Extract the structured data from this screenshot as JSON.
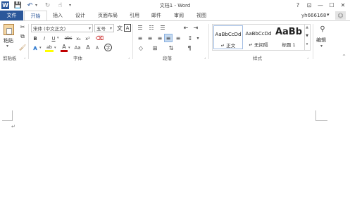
{
  "window": {
    "title": "文档1 - Word",
    "help": "?",
    "ribbon_display": "⊡",
    "minimize": "—",
    "maximize": "☐",
    "close": "✕"
  },
  "quick_access": {
    "word_icon": "W",
    "save": "💾",
    "undo": "↶",
    "undo_dropdown": "▾",
    "redo": "↻",
    "customize": "▾"
  },
  "tabs": [
    "文件",
    "开始",
    "插入",
    "设计",
    "页面布局",
    "引用",
    "邮件",
    "审阅",
    "视图"
  ],
  "account": {
    "name": "yh666168",
    "dropdown": "▾"
  },
  "clipboard": {
    "paste_label": "粘贴",
    "group_label": "剪贴板"
  },
  "font": {
    "name": "宋体 (中文正文)",
    "size": "五号",
    "group_label": "字体",
    "grow": "A",
    "shrink": "A",
    "clear_format": "A",
    "phonetic": "文",
    "border_char": "A",
    "bold": "B",
    "italic": "I",
    "underline": "U",
    "strike": "abc",
    "subscript": "x₂",
    "superscript": "x²",
    "text_effects": "A",
    "highlight": "ab",
    "font_color": "A",
    "case": "Aa",
    "grow2": "A",
    "shrink2": "A",
    "enclose": "字"
  },
  "paragraph": {
    "group_label": "段落",
    "show_marks": "¶"
  },
  "styles": {
    "group_label": "样式",
    "items": [
      {
        "preview": "AaBbCcDd",
        "name": "↵ 正文"
      },
      {
        "preview": "AaBbCcDd",
        "name": "↵ 无间隔"
      },
      {
        "preview": "AaBb",
        "name": "标题 1"
      }
    ]
  },
  "editing": {
    "label": "编辑"
  },
  "document": {
    "paragraph_mark": "↵"
  },
  "colors": {
    "accent": "#2b579a",
    "highlight": "#ffff00",
    "font_red": "#c00000"
  }
}
